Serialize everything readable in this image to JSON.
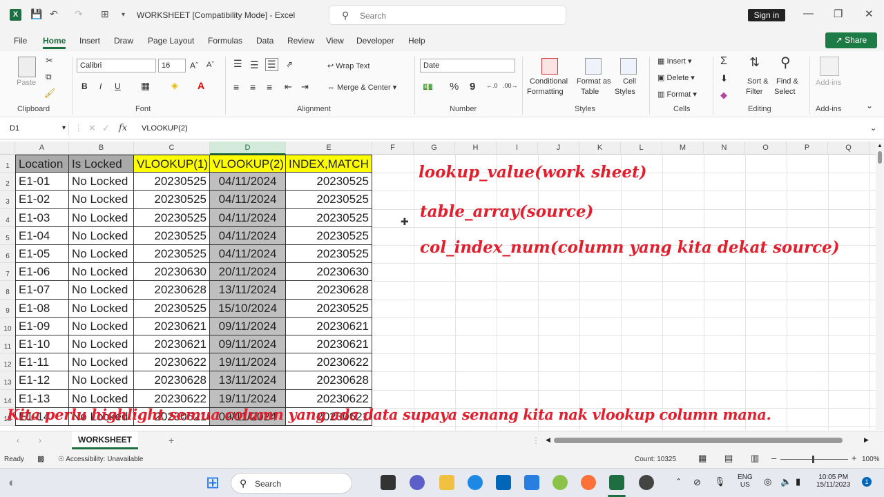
{
  "titlebar": {
    "title": "WORKSHEET  [Compatibility Mode]  -  Excel",
    "search_placeholder": "Search",
    "signin_label": "Sign in",
    "app_logo": "X"
  },
  "menu": {
    "items": [
      "File",
      "Home",
      "Insert",
      "Draw",
      "Page Layout",
      "Formulas",
      "Data",
      "Review",
      "View",
      "Developer",
      "Help"
    ],
    "active": "Home",
    "share_label": "Share"
  },
  "ribbon": {
    "clipboard": {
      "paste": "Paste",
      "label": "Clipboard"
    },
    "font": {
      "name": "Calibri",
      "size": "16",
      "label": "Font",
      "bold": "B",
      "italic": "I",
      "underline": "U"
    },
    "alignment": {
      "wrap": "Wrap Text",
      "merge": "Merge & Center",
      "label": "Alignment"
    },
    "number": {
      "format": "Date",
      "label": "Number",
      "percent": "%",
      "comma": "9"
    },
    "styles": {
      "conditional": "Conditional",
      "conditional2": "Formatting",
      "format_table": "Format as",
      "format_table2": "Table",
      "cell_styles": "Cell",
      "cell_styles2": "Styles",
      "label": "Styles"
    },
    "cells": {
      "insert": "Insert",
      "delete": "Delete",
      "format": "Format",
      "label": "Cells"
    },
    "editing": {
      "sort": "Sort &",
      "sort2": "Filter",
      "find": "Find &",
      "find2": "Select",
      "label": "Editing"
    },
    "addins": {
      "addins": "Add-ins",
      "label": "Add-ins"
    }
  },
  "formula_bar": {
    "name_box": "D1",
    "formula": "VLOOKUP(2)",
    "fx": "fx"
  },
  "grid": {
    "columns": [
      "A",
      "B",
      "C",
      "D",
      "E",
      "F",
      "G",
      "H",
      "I",
      "J",
      "K",
      "L",
      "M",
      "N",
      "O",
      "P",
      "Q"
    ],
    "selected_column": "D",
    "row_numbers": [
      "1",
      "2",
      "3",
      "4",
      "5",
      "6",
      "7",
      "8",
      "9",
      "10",
      "11",
      "12",
      "13",
      "14",
      "15"
    ],
    "header": [
      "Location",
      "Is Locked",
      "VLOOKUP(1)",
      "VLOOKUP(2)",
      "INDEX,MATCH"
    ],
    "rows": [
      [
        "E1-01",
        "No Locked",
        "20230525",
        "04/11/2024",
        "20230525"
      ],
      [
        "E1-02",
        "No Locked",
        "20230525",
        "04/11/2024",
        "20230525"
      ],
      [
        "E1-03",
        "No Locked",
        "20230525",
        "04/11/2024",
        "20230525"
      ],
      [
        "E1-04",
        "No Locked",
        "20230525",
        "04/11/2024",
        "20230525"
      ],
      [
        "E1-05",
        "No Locked",
        "20230525",
        "04/11/2024",
        "20230525"
      ],
      [
        "E1-06",
        "No Locked",
        "20230630",
        "20/11/2024",
        "20230630"
      ],
      [
        "E1-07",
        "No Locked",
        "20230628",
        "13/11/2024",
        "20230628"
      ],
      [
        "E1-08",
        "No Locked",
        "20230525",
        "15/10/2024",
        "20230525"
      ],
      [
        "E1-09",
        "No Locked",
        "20230621",
        "09/11/2024",
        "20230621"
      ],
      [
        "E1-10",
        "No Locked",
        "20230621",
        "09/11/2024",
        "20230621"
      ],
      [
        "E1-11",
        "No Locked",
        "20230622",
        "19/11/2024",
        "20230622"
      ],
      [
        "E1-12",
        "No Locked",
        "20230628",
        "13/11/2024",
        "20230628"
      ],
      [
        "E1-13",
        "No Locked",
        "20230622",
        "19/11/2024",
        "20230622"
      ],
      [
        "E1-14",
        "No Locked",
        "20230621",
        "09/11/2024",
        "20230621"
      ]
    ]
  },
  "annotations": [
    "lookup_value(work sheet)",
    "table_array(source)",
    "col_index_num(column yang kita dekat source)"
  ],
  "subtitle": "Kita perlu highlight semua column yang ada data supaya senang kita nak vlookup column mana.",
  "sheet_tab": "WORKSHEET",
  "statusbar": {
    "ready": "Ready",
    "accessibility": "Accessibility: Unavailable",
    "count": "Count: 10325",
    "zoom": "100%"
  },
  "taskbar": {
    "search_placeholder": "Search",
    "lang1": "ENG",
    "lang2": "US",
    "time": "10:05 PM",
    "date": "15/11/2023"
  },
  "colors": {
    "excel_green": "#1d6f42",
    "annotation_red": "#e0202e",
    "header_yellow": "#ffff00",
    "header_gray": "#a9a9a9"
  }
}
